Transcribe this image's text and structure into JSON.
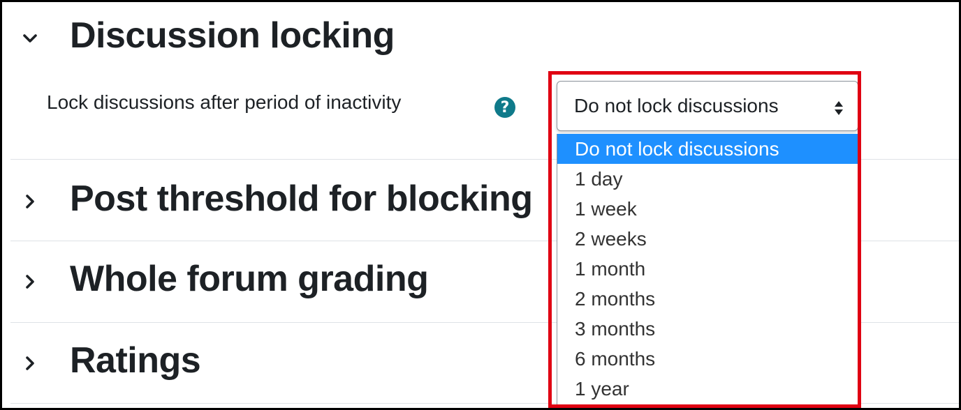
{
  "sections": [
    {
      "title": "Discussion locking",
      "expanded": true
    },
    {
      "title": "Post threshold for blocking",
      "expanded": false
    },
    {
      "title": "Whole forum grading",
      "expanded": false
    },
    {
      "title": "Ratings",
      "expanded": false
    }
  ],
  "field": {
    "label": "Lock discussions after period of inactivity",
    "help_icon": "question-circle-icon",
    "help_glyph": "?"
  },
  "select": {
    "selected_value": "Do not lock discussions",
    "options": [
      "Do not lock discussions",
      "1 day",
      "1 week",
      "2 weeks",
      "1 month",
      "2 months",
      "3 months",
      "6 months",
      "1 year"
    ]
  },
  "colors": {
    "highlight_border": "#e00012",
    "selected_option_bg": "#1e90ff",
    "help_icon_bg": "#0f7a8a"
  }
}
